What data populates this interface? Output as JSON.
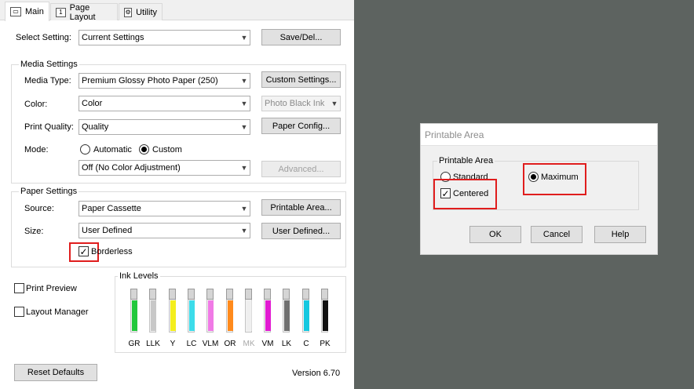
{
  "tabs": [
    {
      "label": "Main",
      "icon": "printer-icon",
      "active": true
    },
    {
      "label": "Page Layout",
      "icon": "page-layout-icon",
      "active": false
    },
    {
      "label": "Utility",
      "icon": "utility-icon",
      "active": false
    }
  ],
  "select_setting": {
    "label": "Select Setting:",
    "value": "Current Settings",
    "button": "Save/Del..."
  },
  "media_settings": {
    "title": "Media Settings",
    "media_type": {
      "label": "Media Type:",
      "value": "Premium Glossy Photo Paper (250)",
      "button": "Custom Settings..."
    },
    "color": {
      "label": "Color:",
      "value": "Color",
      "secondary_value": "Photo Black Ink"
    },
    "print_quality": {
      "label": "Print Quality:",
      "value": "Quality",
      "button": "Paper Config..."
    },
    "mode": {
      "label": "Mode:",
      "options": [
        "Automatic",
        "Custom"
      ],
      "selected": "Custom",
      "value": "Off (No Color Adjustment)",
      "button": "Advanced..."
    }
  },
  "paper_settings": {
    "title": "Paper Settings",
    "source": {
      "label": "Source:",
      "value": "Paper Cassette",
      "button": "Printable Area..."
    },
    "size": {
      "label": "Size:",
      "value": "User Defined",
      "button": "User Defined..."
    },
    "borderless": {
      "label": "Borderless",
      "checked": true
    }
  },
  "print_preview": {
    "label": "Print Preview",
    "checked": false
  },
  "layout_manager": {
    "label": "Layout Manager",
    "checked": false
  },
  "ink_levels": {
    "title": "Ink Levels",
    "inks": [
      {
        "label": "GR",
        "color": "#22c83c",
        "level": 0.72,
        "enabled": true
      },
      {
        "label": "LLK",
        "color": "#c8c8c8",
        "level": 0.72,
        "enabled": true
      },
      {
        "label": "Y",
        "color": "#f4ee1c",
        "level": 0.72,
        "enabled": true
      },
      {
        "label": "LC",
        "color": "#3cdcea",
        "level": 0.72,
        "enabled": true
      },
      {
        "label": "VLM",
        "color": "#f07ae6",
        "level": 0.72,
        "enabled": true
      },
      {
        "label": "OR",
        "color": "#ff8a1c",
        "level": 0.72,
        "enabled": true
      },
      {
        "label": "MK",
        "color": "#ececec",
        "level": 0.72,
        "enabled": false
      },
      {
        "label": "VM",
        "color": "#e21ad2",
        "level": 0.72,
        "enabled": true
      },
      {
        "label": "LK",
        "color": "#707070",
        "level": 0.72,
        "enabled": true
      },
      {
        "label": "C",
        "color": "#14c8e0",
        "level": 0.72,
        "enabled": true
      },
      {
        "label": "PK",
        "color": "#111111",
        "level": 0.72,
        "enabled": true
      }
    ]
  },
  "footer": {
    "reset_button": "Reset Defaults",
    "version": "Version 6.70"
  },
  "printable_area_dialog": {
    "title": "Printable Area",
    "group_title": "Printable Area",
    "options": [
      "Standard",
      "Maximum"
    ],
    "selected": "Maximum",
    "centered": {
      "label": "Centered",
      "checked": true
    },
    "buttons": {
      "ok": "OK",
      "cancel": "Cancel",
      "help": "Help"
    }
  },
  "colors": {
    "highlight": "#e01d1d",
    "background": "#5d6360"
  }
}
